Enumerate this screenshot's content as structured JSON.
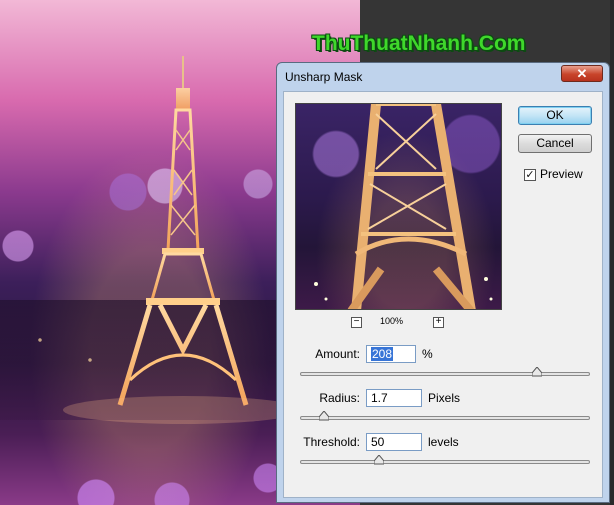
{
  "logo": {
    "text": "ThuThuatNhanh.Com"
  },
  "dialog": {
    "title": "Unsharp Mask",
    "close_symbol": "✕",
    "ok_label": "OK",
    "cancel_label": "Cancel",
    "preview_checkbox": {
      "label": "Preview",
      "checked": true,
      "mark": "✓"
    },
    "zoom": {
      "minus": "−",
      "plus": "+",
      "level": "100%"
    },
    "amount": {
      "label": "Amount:",
      "value": "208",
      "unit": "%",
      "slider_fraction": 0.82
    },
    "radius": {
      "label": "Radius:",
      "value": "1.7",
      "unit": "Pixels",
      "slider_fraction": 0.08
    },
    "threshold": {
      "label": "Threshold:",
      "value": "50",
      "unit": "levels",
      "slider_fraction": 0.27
    }
  },
  "icons": {
    "close": "close-icon",
    "checkbox": "checkmark-icon",
    "zoom_out": "minus-icon",
    "zoom_in": "plus-icon"
  },
  "colors": {
    "dialog_frame": "#bfd3ec",
    "close_button": "#c8442b",
    "selection": "#3875d7",
    "logo_green": "#3fd82b"
  }
}
